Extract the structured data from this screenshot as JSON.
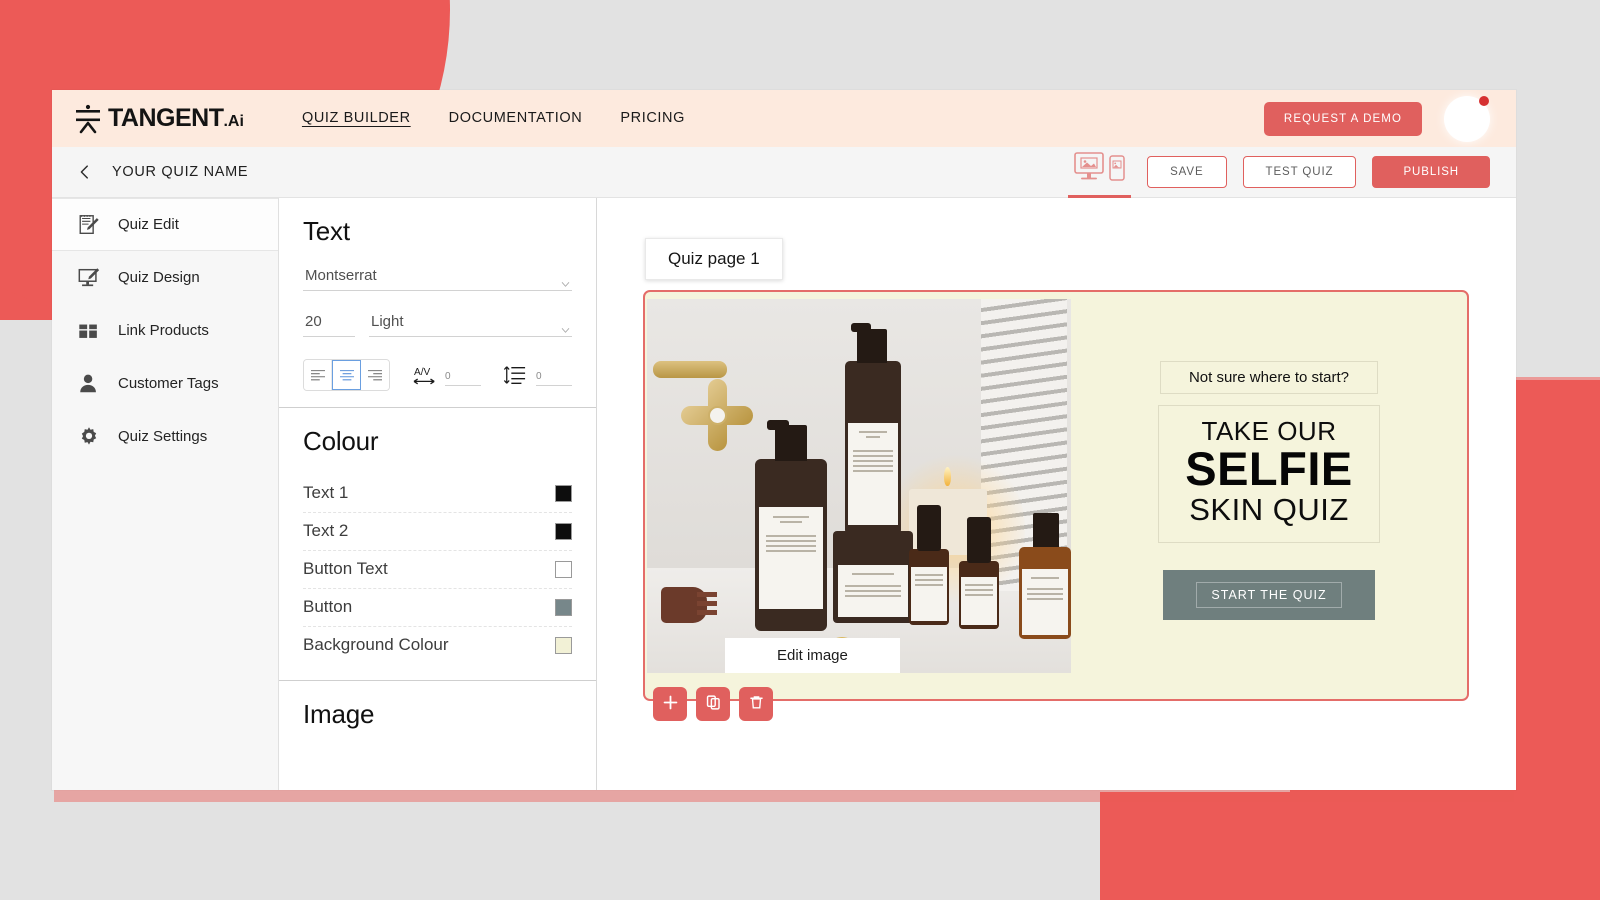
{
  "brand": {
    "logo_text": "TANGENT",
    "logo_suffix": ".Ai",
    "logo_icon": "tangent-person-mark"
  },
  "topnav": {
    "links": [
      {
        "label": "QUIZ BUILDER",
        "active": true
      },
      {
        "label": "DOCUMENTATION",
        "active": false
      },
      {
        "label": "PRICING",
        "active": false
      }
    ],
    "demo_button": "REQUEST A DEMO",
    "avatar_has_notification": true
  },
  "subbar": {
    "back_icon": "chevron-left-icon",
    "quiz_name": "YOUR QUIZ NAME",
    "device_toggle": {
      "desktop_icon": "desktop-preview-icon",
      "mobile_icon": "mobile-preview-icon",
      "active": "desktop"
    },
    "save_label": "SAVE",
    "test_label": "TEST QUIZ",
    "publish_label": "PUBLISH"
  },
  "sidebar": {
    "items": [
      {
        "label": "Quiz  Edit",
        "icon": "notepad-pencil-icon",
        "active": true
      },
      {
        "label": "Quiz  Design",
        "icon": "monitor-pencil-icon",
        "active": false
      },
      {
        "label": "Link Products",
        "icon": "products-box-icon",
        "active": false
      },
      {
        "label": "Customer Tags",
        "icon": "person-icon",
        "active": false
      },
      {
        "label": "Quiz  Settings",
        "icon": "gear-icon",
        "active": false
      }
    ]
  },
  "properties": {
    "text": {
      "title": "Text",
      "font_family": "Montserrat",
      "font_size": "20",
      "font_weight": "Light",
      "alignment": {
        "options": [
          "left",
          "center",
          "right"
        ],
        "selected": "center"
      },
      "letter_spacing_icon": "letter-spacing-icon",
      "letter_spacing": "0",
      "line_height_icon": "line-height-icon",
      "line_height": "0"
    },
    "colour": {
      "title": "Colour",
      "rows": [
        {
          "label": "Text 1",
          "value": "#0d0d0d"
        },
        {
          "label": "Text 2",
          "value": "#0d0d0d"
        },
        {
          "label": "Button Text",
          "value": "#ffffff"
        },
        {
          "label": "Button",
          "value": "#77878a"
        },
        {
          "label": "Background Colour",
          "value": "#f2f1d6"
        }
      ]
    },
    "image": {
      "title": "Image"
    }
  },
  "canvas": {
    "page_tab": "Quiz page 1",
    "card": {
      "background_colour": "#f5f4dc",
      "border_colour": "#e46d69",
      "edit_image_label": "Edit image",
      "image_alt": "m.greengrass skincare bottles on marble counter with gold faucet, candle and striped towel",
      "subtitle": "Not sure where to start?",
      "headline_line1": "TAKE OUR",
      "headline_line2": "SELFIE",
      "headline_line3": "SKIN QUIZ",
      "cta_label": "START THE QUIZ",
      "cta_bg": "#6f7f7e"
    },
    "actions": [
      {
        "name": "add-page-button",
        "icon": "plus-icon"
      },
      {
        "name": "duplicate-page-button",
        "icon": "duplicate-icon"
      },
      {
        "name": "delete-page-button",
        "icon": "trash-icon"
      }
    ]
  },
  "theme": {
    "accent_red": "#e0605e",
    "bg_red": "#ec5a57",
    "nav_cream": "#fdeade",
    "page_grey": "#e2e2e2"
  }
}
